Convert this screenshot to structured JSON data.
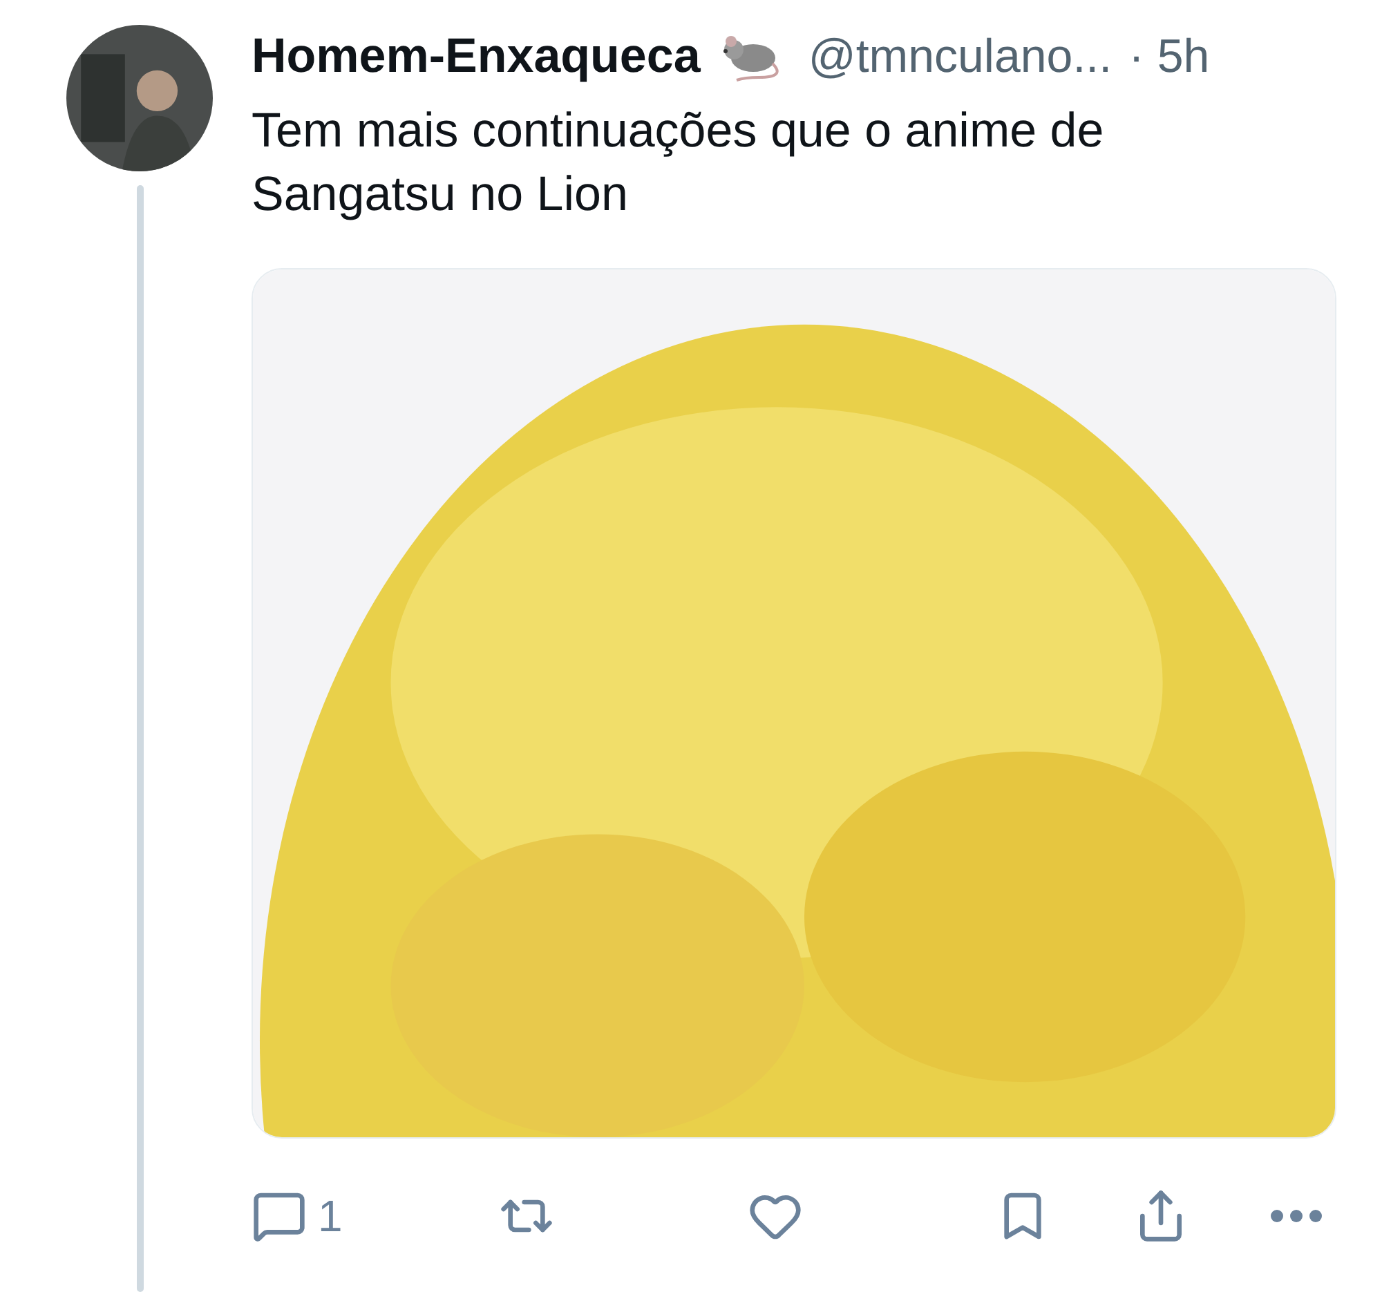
{
  "post": {
    "author": "Homem-Enxaqueca",
    "handle": "@tmnculano...",
    "time": "· 5h",
    "text": "Tem mais continuações que o anime de Sangatsu no Lion"
  },
  "actions": [
    {
      "kind": "reply",
      "count": "1"
    },
    {
      "kind": "repost"
    },
    {
      "kind": "like"
    },
    {
      "kind": "bookmark"
    },
    {
      "kind": "share"
    },
    {
      "kind": "more"
    }
  ]
}
